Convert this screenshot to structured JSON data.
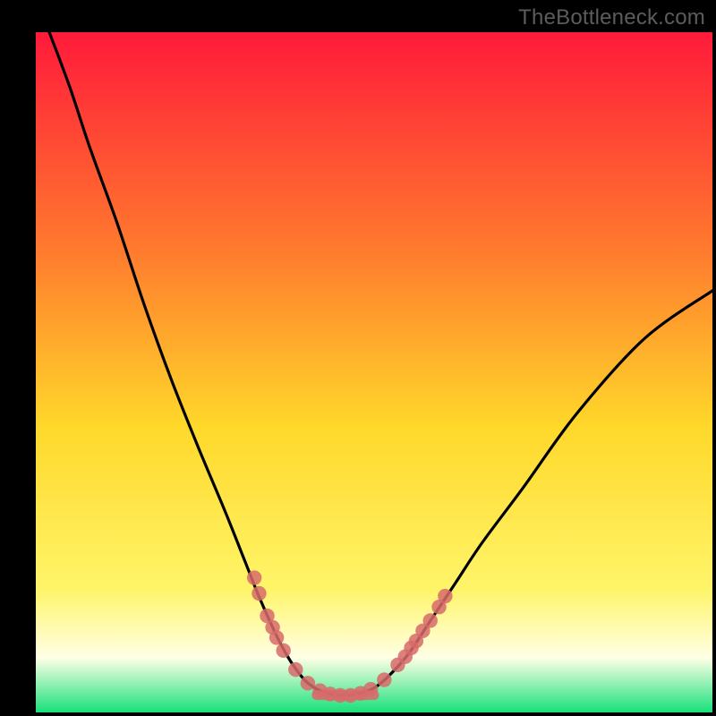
{
  "watermark": "TheBottleneck.com",
  "colors": {
    "bg_black": "#000000",
    "grad_top": "#ff1a3a",
    "grad_mid_upper": "#ff7a2e",
    "grad_mid": "#ffd82a",
    "grad_low": "#fff56a",
    "grad_white": "#ffffe6",
    "grad_bottom": "#18e07a",
    "curve": "#000000",
    "marker_fill": "#d76a6a",
    "marker_stroke": "#b94f4f"
  },
  "chart_data": {
    "type": "line",
    "title": "",
    "xlabel": "",
    "ylabel": "",
    "xlim": [
      0,
      100
    ],
    "ylim": [
      0,
      100
    ],
    "grid": false,
    "series": [
      {
        "name": "bottleneck-curve",
        "x": [
          2,
          5,
          8,
          12,
          16,
          20,
          24,
          28,
          31,
          33,
          35,
          36.5,
          38,
          40,
          42,
          44,
          46,
          48,
          50,
          52,
          55,
          58,
          62,
          66,
          72,
          80,
          90,
          100
        ],
        "y": [
          100,
          92,
          83,
          72,
          60,
          49,
          39,
          29.5,
          22,
          17,
          12.5,
          9.5,
          7,
          4.5,
          3.2,
          2.6,
          2.5,
          2.8,
          3.6,
          5.2,
          8.5,
          13,
          19,
          25,
          33,
          44,
          55,
          62
        ]
      }
    ],
    "markers": [
      {
        "x": 32.3,
        "y": 19.8
      },
      {
        "x": 33.0,
        "y": 17.5
      },
      {
        "x": 34.2,
        "y": 14.2
      },
      {
        "x": 35.0,
        "y": 12.5
      },
      {
        "x": 35.6,
        "y": 11.0
      },
      {
        "x": 36.6,
        "y": 9.1
      },
      {
        "x": 38.4,
        "y": 6.3
      },
      {
        "x": 40.2,
        "y": 4.3
      },
      {
        "x": 42.0,
        "y": 3.2
      },
      {
        "x": 43.5,
        "y": 2.7
      },
      {
        "x": 45.0,
        "y": 2.5
      },
      {
        "x": 46.5,
        "y": 2.5
      },
      {
        "x": 48.0,
        "y": 2.8
      },
      {
        "x": 49.5,
        "y": 3.4
      },
      {
        "x": 51.5,
        "y": 4.8
      },
      {
        "x": 53.5,
        "y": 7.0
      },
      {
        "x": 54.6,
        "y": 8.2
      },
      {
        "x": 55.5,
        "y": 9.5
      },
      {
        "x": 56.2,
        "y": 10.5
      },
      {
        "x": 57.2,
        "y": 12.0
      },
      {
        "x": 58.3,
        "y": 13.5
      },
      {
        "x": 59.6,
        "y": 15.5
      },
      {
        "x": 60.5,
        "y": 17.1
      }
    ],
    "flat_segment": {
      "x0": 41.5,
      "x1": 50.0,
      "y": 2.55
    }
  }
}
